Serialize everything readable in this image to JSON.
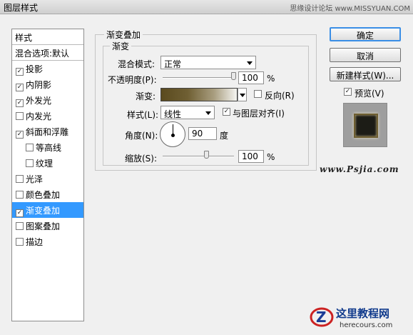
{
  "window": {
    "title": "图层样式",
    "watermark_top": "思缘设计论坛 www.MISSYUAN.COM"
  },
  "style_list": {
    "header": "样式",
    "blend_options": "混合选项:默认",
    "items": [
      {
        "label": "投影",
        "checked": true,
        "indent": false,
        "selected": false
      },
      {
        "label": "内阴影",
        "checked": true,
        "indent": false,
        "selected": false
      },
      {
        "label": "外发光",
        "checked": true,
        "indent": false,
        "selected": false
      },
      {
        "label": "内发光",
        "checked": false,
        "indent": false,
        "selected": false
      },
      {
        "label": "斜面和浮雕",
        "checked": true,
        "indent": false,
        "selected": false
      },
      {
        "label": "等高线",
        "checked": false,
        "indent": true,
        "selected": false
      },
      {
        "label": "纹理",
        "checked": false,
        "indent": true,
        "selected": false
      },
      {
        "label": "光泽",
        "checked": false,
        "indent": false,
        "selected": false
      },
      {
        "label": "颜色叠加",
        "checked": false,
        "indent": false,
        "selected": false
      },
      {
        "label": "渐变叠加",
        "checked": true,
        "indent": false,
        "selected": true
      },
      {
        "label": "图案叠加",
        "checked": false,
        "indent": false,
        "selected": false
      },
      {
        "label": "描边",
        "checked": false,
        "indent": false,
        "selected": false
      }
    ]
  },
  "gradient_overlay": {
    "outer_title": "渐变叠加",
    "inner_title": "渐变",
    "blend_mode_label": "混合模式:",
    "blend_mode_value": "正常",
    "opacity_label": "不透明度(P):",
    "opacity_value": "100",
    "opacity_fraction": 1.0,
    "percent": "%",
    "gradient_label": "渐变:",
    "reverse_label": "反向(R)",
    "reverse_checked": false,
    "style_label": "样式(L):",
    "style_value": "线性",
    "align_label": "与图层对齐(I)",
    "align_checked": true,
    "angle_label": "角度(N):",
    "angle_value": "90",
    "degree_unit": "度",
    "scale_label": "缩放(S):",
    "scale_value": "100",
    "scale_fraction": 0.5
  },
  "buttons": {
    "ok": "确定",
    "cancel": "取消",
    "new_style": "新建样式(W)...",
    "preview_label": "预览(V)",
    "preview_checked": true
  },
  "overlays": {
    "site_watermark": "www.Psjia.com",
    "brand_cn": "这里教程网",
    "brand_en": "herecours.com"
  },
  "colors": {
    "selection": "#3399ff",
    "gradient_start": "#5a4a1f",
    "gradient_end": "#f5f5f2"
  }
}
